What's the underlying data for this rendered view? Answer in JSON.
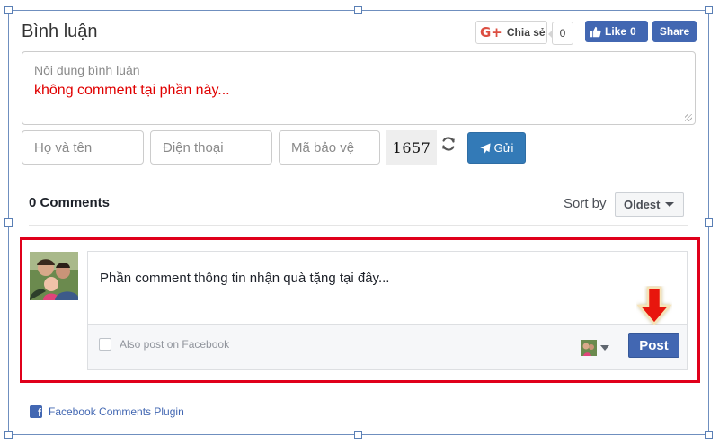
{
  "header": {
    "title": "Bình luận",
    "google_share": {
      "icon": "google-plus-icon",
      "label": "Chia sẻ",
      "count": "0"
    },
    "facebook": {
      "like_label": "Like",
      "like_count": "0",
      "share_label": "Share"
    }
  },
  "comment_form": {
    "content_placeholder": "Nội dung bình luận",
    "content_note": "không comment tại phần này...",
    "name_placeholder": "Họ và tên",
    "phone_placeholder": "Điện thoại",
    "captcha_placeholder": "Mã bảo vệ",
    "captcha_value": "1657",
    "send_label": "Gửi"
  },
  "facebook_comments": {
    "count_label": "0 Comments",
    "sort_label": "Sort by",
    "sort_value": "Oldest",
    "input_text": "Phần comment thông tin nhận quà tặng tại đây...",
    "also_post_label": "Also post on Facebook",
    "post_label": "Post",
    "plugin_label": "Facebook Comments Plugin"
  },
  "colors": {
    "facebook_blue": "#4267b2",
    "button_blue": "#337ab7",
    "highlight_red": "#e0001b",
    "note_red": "#e00000"
  }
}
